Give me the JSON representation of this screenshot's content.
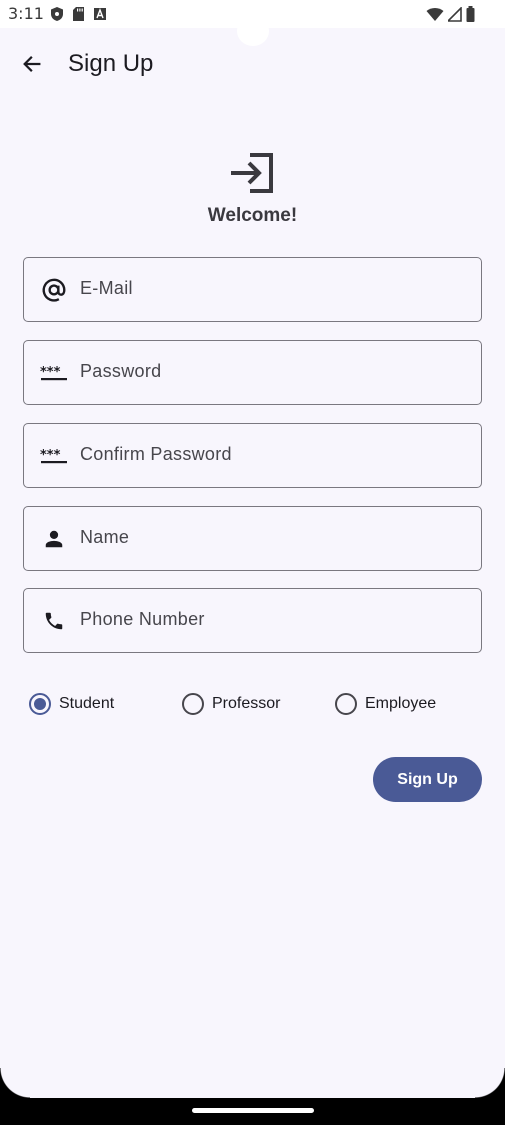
{
  "status_bar": {
    "time": "3:11",
    "left_icons": [
      "shield-icon",
      "sd-card-icon",
      "font-a-icon"
    ],
    "right_icons": [
      "wifi-icon",
      "signal-icon",
      "battery-icon"
    ]
  },
  "app_bar": {
    "back_icon": "arrow-left-icon",
    "title": "Sign Up"
  },
  "header": {
    "icon": "login-icon",
    "welcome": "Welcome!"
  },
  "fields": [
    {
      "icon": "at-sign-icon",
      "label": "E-Mail"
    },
    {
      "icon": "password-icon",
      "label": "Password"
    },
    {
      "icon": "password-icon",
      "label": "Confirm Password"
    },
    {
      "icon": "person-icon",
      "label": "Name"
    },
    {
      "icon": "phone-icon",
      "label": "Phone Number"
    }
  ],
  "roles": {
    "options": [
      "Student",
      "Professor",
      "Employee"
    ],
    "selected": "Student"
  },
  "submit": {
    "label": "Sign Up"
  },
  "colors": {
    "background": "#f8f6fd",
    "primary": "#4a5a96",
    "outline": "#7a7880",
    "text": "#1c1b21"
  }
}
